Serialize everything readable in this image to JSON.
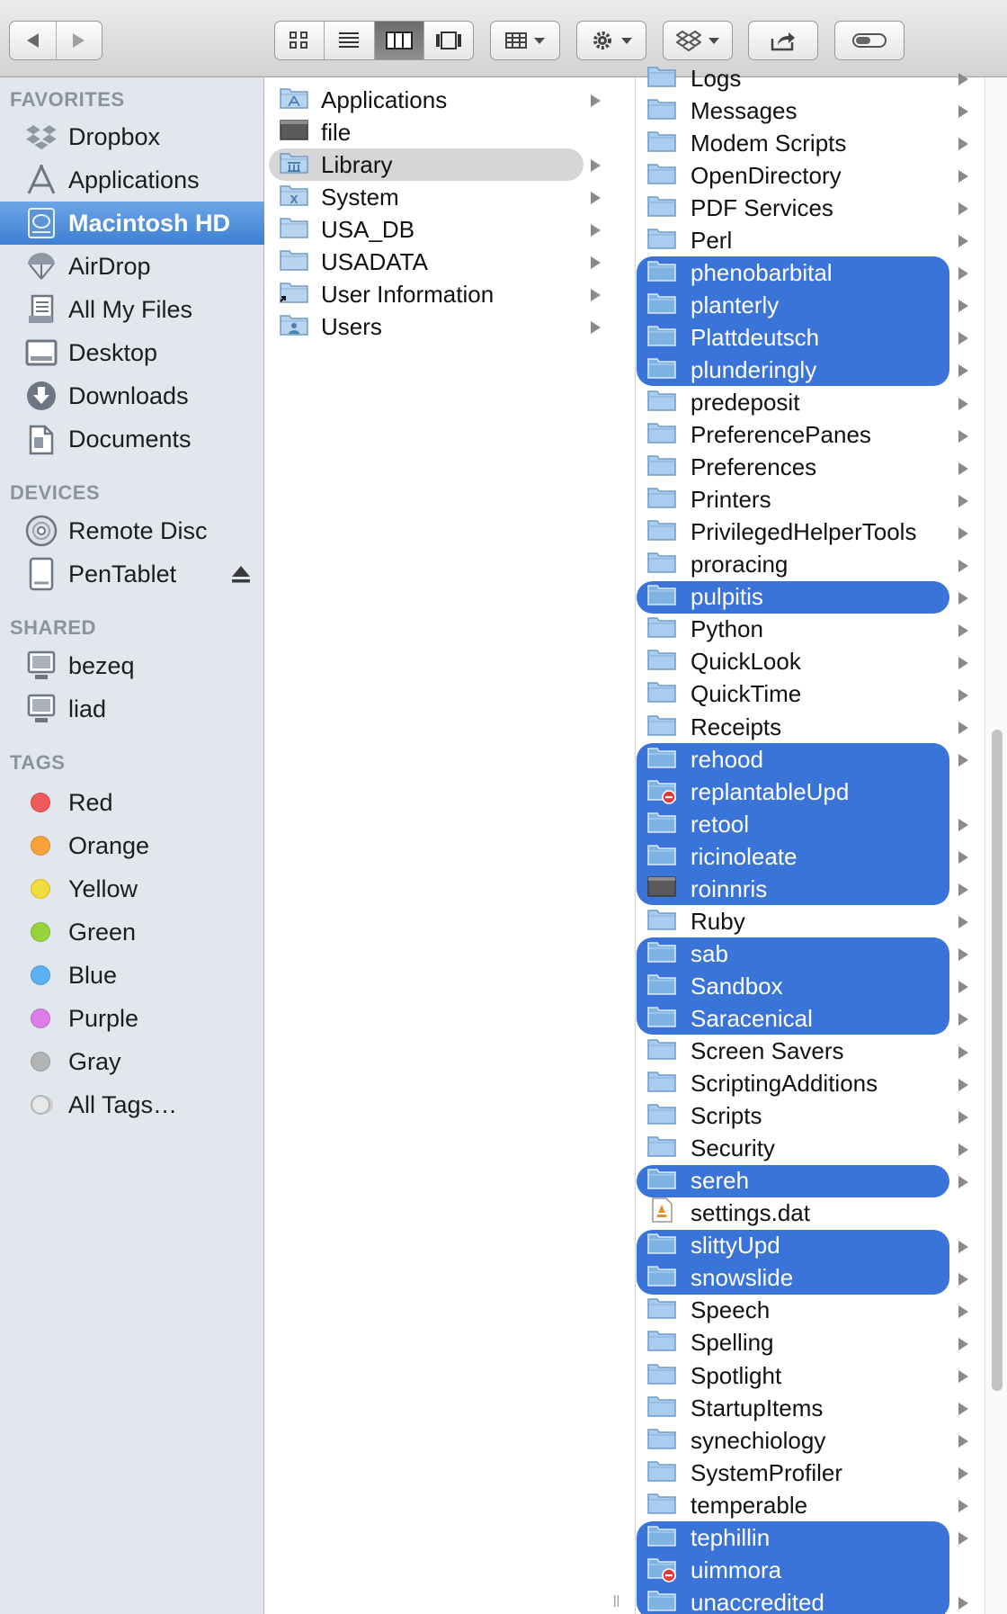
{
  "toolbar": {
    "nav": [
      "back-icon",
      "forward-icon"
    ],
    "view_modes": [
      "icon-view-icon",
      "list-view-icon",
      "column-view-icon",
      "coverflow-view-icon"
    ],
    "active_view": "column-view-icon",
    "arrange_icon": "arrange-grid-icon",
    "action_icon": "gear-icon",
    "dropbox_icon": "dropbox-icon",
    "share_icon": "share-icon",
    "tags_icon": "tag-toggle-icon"
  },
  "sidebar": {
    "favorites_header": "FAVORITES",
    "favorites": [
      {
        "label": "Dropbox",
        "icon": "dropbox-icon"
      },
      {
        "label": "Applications",
        "icon": "applications-icon"
      },
      {
        "label": "Macintosh HD",
        "icon": "harddisk-icon",
        "selected": true
      },
      {
        "label": "AirDrop",
        "icon": "airdrop-icon"
      },
      {
        "label": "All My Files",
        "icon": "all-files-icon"
      },
      {
        "label": "Desktop",
        "icon": "desktop-icon"
      },
      {
        "label": "Downloads",
        "icon": "downloads-icon"
      },
      {
        "label": "Documents",
        "icon": "documents-icon"
      }
    ],
    "devices_header": "DEVICES",
    "devices": [
      {
        "label": "Remote Disc",
        "icon": "disc-icon"
      },
      {
        "label": "PenTablet",
        "icon": "external-drive-icon",
        "ejectable": true
      }
    ],
    "shared_header": "SHARED",
    "shared": [
      {
        "label": "bezeq",
        "icon": "network-computer-icon"
      },
      {
        "label": "liad",
        "icon": "network-computer-icon"
      }
    ],
    "tags_header": "TAGS",
    "tags": [
      {
        "label": "Red",
        "color": "#f05a5a"
      },
      {
        "label": "Orange",
        "color": "#f7a33a"
      },
      {
        "label": "Yellow",
        "color": "#f2dc3b"
      },
      {
        "label": "Green",
        "color": "#97d43c"
      },
      {
        "label": "Blue",
        "color": "#5cb1f2"
      },
      {
        "label": "Purple",
        "color": "#de7ce8"
      },
      {
        "label": "Gray",
        "color": "#b3b3b3"
      },
      {
        "label": "All Tags…",
        "color": "#d9d9d9"
      }
    ]
  },
  "column1": {
    "items": [
      {
        "label": "Applications",
        "icon": "applications-folder-icon"
      },
      {
        "label": "file",
        "icon": "terminal-file-icon"
      },
      {
        "label": "Library",
        "icon": "library-folder-icon",
        "selected": true
      },
      {
        "label": "System",
        "icon": "system-folder-icon"
      },
      {
        "label": "USA_DB",
        "icon": "folder-icon"
      },
      {
        "label": "USADATA",
        "icon": "folder-icon"
      },
      {
        "label": "User Information",
        "icon": "alias-folder-icon"
      },
      {
        "label": "Users",
        "icon": "users-folder-icon"
      }
    ]
  },
  "column2": {
    "items": [
      {
        "label": "Logs"
      },
      {
        "label": "Messages"
      },
      {
        "label": "Modem Scripts"
      },
      {
        "label": "OpenDirectory"
      },
      {
        "label": "PDF Services"
      },
      {
        "label": "Perl"
      },
      {
        "label": "phenobarbital",
        "selected": true
      },
      {
        "label": "planterly",
        "selected": true
      },
      {
        "label": "Plattdeutsch",
        "selected": true
      },
      {
        "label": "plunderingly",
        "selected": true
      },
      {
        "label": "predeposit"
      },
      {
        "label": "PreferencePanes"
      },
      {
        "label": "Preferences"
      },
      {
        "label": "Printers"
      },
      {
        "label": "PrivilegedHelperTools"
      },
      {
        "label": "proracing"
      },
      {
        "label": "pulpitis",
        "selected": true
      },
      {
        "label": "Python"
      },
      {
        "label": "QuickLook"
      },
      {
        "label": "QuickTime"
      },
      {
        "label": "Receipts"
      },
      {
        "label": "rehood",
        "selected": true
      },
      {
        "label": "replantableUpd",
        "selected": true,
        "restricted": true
      },
      {
        "label": "retool",
        "selected": true
      },
      {
        "label": "ricinoleate",
        "selected": true
      },
      {
        "label": "roinnris",
        "selected": true,
        "kind": "file"
      },
      {
        "label": "Ruby"
      },
      {
        "label": "sab",
        "selected": true
      },
      {
        "label": "Sandbox",
        "selected": true
      },
      {
        "label": "Saracenical",
        "selected": true
      },
      {
        "label": "Screen Savers"
      },
      {
        "label": "ScriptingAdditions"
      },
      {
        "label": "Scripts"
      },
      {
        "label": "Security"
      },
      {
        "label": "sereh",
        "selected": true
      },
      {
        "label": "settings.dat",
        "kind": "document"
      },
      {
        "label": "slittyUpd",
        "selected": true
      },
      {
        "label": "snowslide",
        "selected": true
      },
      {
        "label": "Speech"
      },
      {
        "label": "Spelling"
      },
      {
        "label": "Spotlight"
      },
      {
        "label": "StartupItems"
      },
      {
        "label": "synechiology"
      },
      {
        "label": "SystemProfiler"
      },
      {
        "label": "temperable"
      },
      {
        "label": "tephillin",
        "selected": true
      },
      {
        "label": "uimmora",
        "selected": true,
        "restricted": true
      },
      {
        "label": "unaccredited",
        "selected": true
      }
    ]
  },
  "colors": {
    "selection_blue": "#3b74d8",
    "sidebar_selected": "#4a8ad8",
    "sidebar_bg": "#e2e7ed",
    "folder_blue": "#8fbfe8"
  }
}
